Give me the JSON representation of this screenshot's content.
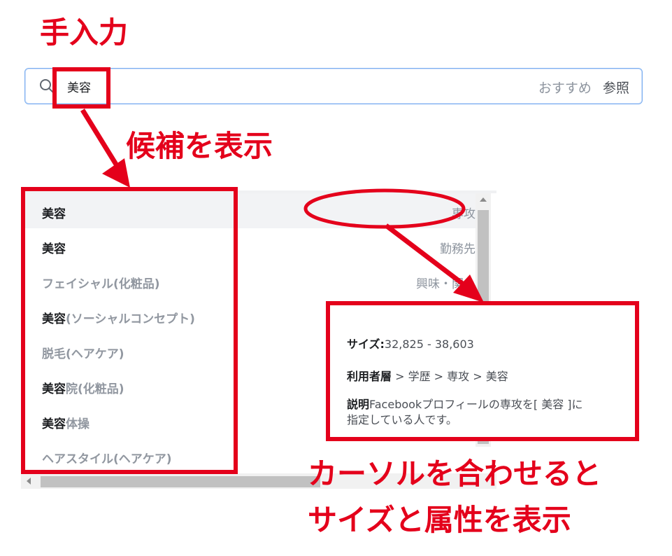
{
  "annotations": {
    "manual_input": "手入力",
    "show_candidates": "候補を表示",
    "hover_line1": "カーソルを合わせると",
    "hover_line2": "サイズと属性を表示"
  },
  "search": {
    "value": "美容",
    "recommended": "おすすめ",
    "browse": "参照"
  },
  "suggestions": [
    {
      "label": "美容",
      "category": "専攻",
      "style": "dark"
    },
    {
      "label": "美容",
      "category": "勤務先",
      "style": "dark"
    },
    {
      "label": "フェイシャル(化粧品)",
      "category": "興味・関心",
      "style": "gray"
    },
    {
      "label_bold": "美容",
      "label_rest": "(ソーシャルコンセプト)",
      "style": "mixed"
    },
    {
      "label": "脱毛(ヘアケア)",
      "style": "gray"
    },
    {
      "label_bold": "美容",
      "label_rest": "院(化粧品)",
      "style": "mixed"
    },
    {
      "label_bold": "美容",
      "label_rest": "体操",
      "style": "mixed"
    },
    {
      "label": "ヘアスタイル(ヘアケア)",
      "style": "gray"
    }
  ],
  "tooltip": {
    "size_label": "サイズ:",
    "size_value": "32,825 - 38,603",
    "audience_label": "利用者層",
    "audience_path": " > 学歴 > 専攻 > 美容",
    "desc_label": "説明",
    "desc_line1": "Facebookプロフィールの専攻を[ 美容 ]に",
    "desc_line2": "指定している人です。"
  },
  "colors": {
    "annotation_red": "#e4001b",
    "input_border": "#7aaef0"
  }
}
